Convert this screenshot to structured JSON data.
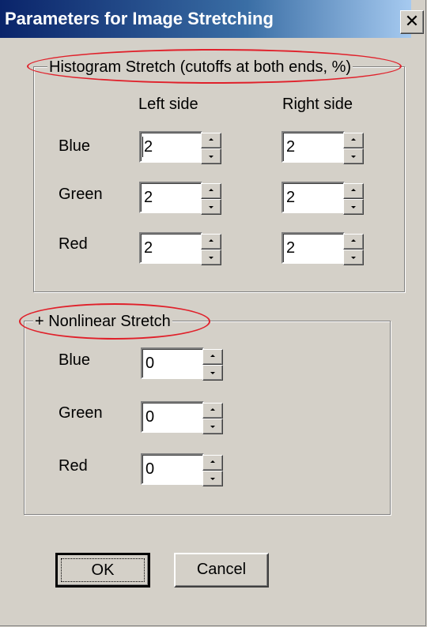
{
  "window": {
    "title": "Parameters for Image Stretching",
    "close_glyph": "✕"
  },
  "histogram": {
    "legend": "Histogram Stretch (cutoffs at both ends, %)",
    "left_header": "Left side",
    "right_header": "Right side",
    "rows": [
      {
        "label": "Blue",
        "left": "2",
        "right": "2"
      },
      {
        "label": "Green",
        "left": "2",
        "right": "2"
      },
      {
        "label": "Red",
        "left": "2",
        "right": "2"
      }
    ]
  },
  "nonlinear": {
    "legend": "+ Nonlinear Stretch",
    "rows": [
      {
        "label": "Blue",
        "value": "0"
      },
      {
        "label": "Green",
        "value": "0"
      },
      {
        "label": "Red",
        "value": "0"
      }
    ]
  },
  "buttons": {
    "ok_label": "OK",
    "cancel_label": "Cancel"
  },
  "annotation_color": "#e0202a",
  "titlebar_color": "#0a246a",
  "dialog_bg": "#d4d0c8"
}
